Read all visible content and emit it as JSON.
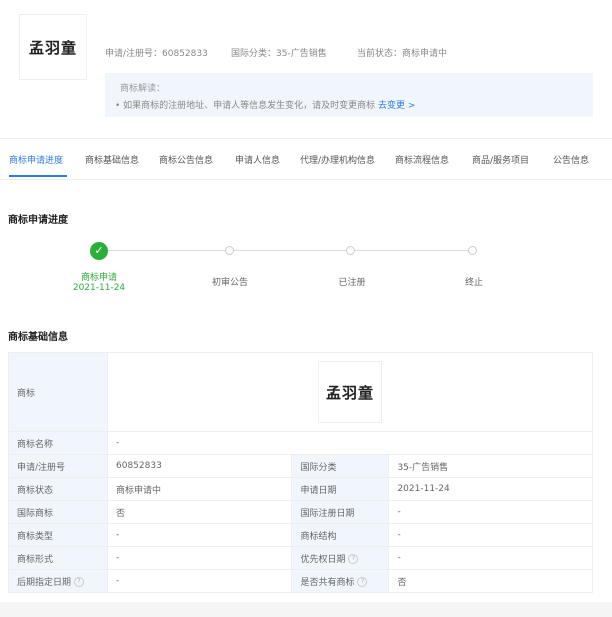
{
  "header": {
    "logo_text": "孟羽童",
    "reg_no": "申请/注册号：60852833",
    "intl_class": "国际分类：35-广告销售",
    "status": "当前状态：商标申请中"
  },
  "tip": {
    "title": "商标解读：",
    "text": "• 如果商标的注册地址、申请人等信息发生变化，请及时变更商标",
    "link": "去变更 >"
  },
  "tabs": [
    "商标申请进度",
    "商标基础信息",
    "商标公告信息",
    "申请人信息",
    "代理/办理机构信息",
    "商标流程信息",
    "商品/服务项目",
    "公告信息"
  ],
  "progress": {
    "title": "商标申请进度",
    "steps": [
      {
        "label": "商标申请",
        "date": "2021-11-24"
      },
      {
        "label": "初审公告"
      },
      {
        "label": "已注册"
      },
      {
        "label": "终止"
      }
    ]
  },
  "basic": {
    "title": "商标基础信息",
    "logo_label": "商标",
    "logo_text": "孟羽童",
    "name_label": "商标名称",
    "name_value": "-",
    "rows": [
      {
        "l1": "申请/注册号",
        "v1": "60852833",
        "l2": "国际分类",
        "v2": "35-广告销售"
      },
      {
        "l1": "商标状态",
        "v1": "商标申请中",
        "l2": "申请日期",
        "v2": "2021-11-24"
      },
      {
        "l1": "国际商标",
        "v1": "否",
        "l2": "国际注册日期",
        "v2": "-"
      },
      {
        "l1": "商标类型",
        "v1": "-",
        "l2": "商标结构",
        "v2": "-"
      },
      {
        "l1": "商标形式",
        "v1": "-",
        "l2": "优先权日期",
        "v2": "-"
      },
      {
        "l1": "后期指定日期",
        "v1": "-",
        "l2": "是否共有商标",
        "v2": "否"
      }
    ]
  },
  "colors": {
    "accent": "#2b7ce9",
    "done": "#2cae3b",
    "label_bg": "#f1f6fd"
  }
}
